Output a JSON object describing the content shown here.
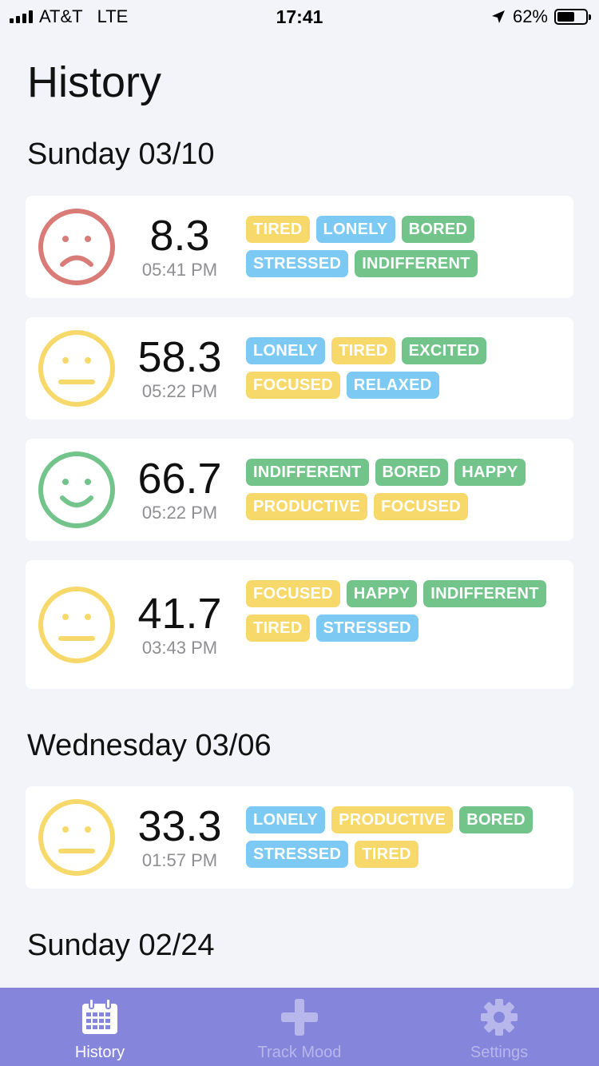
{
  "status_bar": {
    "carrier": "AT&T",
    "network": "LTE",
    "time": "17:41",
    "battery": "62%",
    "battery_level": 0.62
  },
  "page": {
    "title": "History"
  },
  "colors": {
    "red": "#d97b77",
    "yellow": "#f7d96b",
    "green": "#72c48b",
    "blue": "#7ccaf4",
    "tabbar": "#8585dc"
  },
  "sections": [
    {
      "title": "Sunday 03/10",
      "entries": [
        {
          "mood": "sad",
          "score": "8.3",
          "time": "05:41 PM",
          "tags": [
            {
              "label": "TIRED",
              "color": "yellow"
            },
            {
              "label": "LONELY",
              "color": "blue"
            },
            {
              "label": "BORED",
              "color": "green"
            },
            {
              "label": "STRESSED",
              "color": "blue"
            },
            {
              "label": "INDIFFERENT",
              "color": "green"
            }
          ]
        },
        {
          "mood": "neutral",
          "score": "58.3",
          "time": "05:22 PM",
          "tags": [
            {
              "label": "LONELY",
              "color": "blue"
            },
            {
              "label": "TIRED",
              "color": "yellow"
            },
            {
              "label": "EXCITED",
              "color": "green"
            },
            {
              "label": "FOCUSED",
              "color": "yellow"
            },
            {
              "label": "RELAXED",
              "color": "blue"
            }
          ]
        },
        {
          "mood": "happy",
          "score": "66.7",
          "time": "05:22 PM",
          "tags": [
            {
              "label": "INDIFFERENT",
              "color": "green"
            },
            {
              "label": "BORED",
              "color": "green"
            },
            {
              "label": "HAPPY",
              "color": "green"
            },
            {
              "label": "PRODUCTIVE",
              "color": "yellow"
            },
            {
              "label": "FOCUSED",
              "color": "yellow"
            }
          ]
        },
        {
          "mood": "neutral",
          "score": "41.7",
          "time": "03:43 PM",
          "tags": [
            {
              "label": "FOCUSED",
              "color": "yellow"
            },
            {
              "label": "HAPPY",
              "color": "green"
            },
            {
              "label": "INDIFFERENT",
              "color": "green"
            },
            {
              "label": "TIRED",
              "color": "yellow"
            },
            {
              "label": "STRESSED",
              "color": "blue"
            }
          ]
        }
      ]
    },
    {
      "title": "Wednesday 03/06",
      "entries": [
        {
          "mood": "neutral",
          "score": "33.3",
          "time": "01:57 PM",
          "tags": [
            {
              "label": "LONELY",
              "color": "blue"
            },
            {
              "label": "PRODUCTIVE",
              "color": "yellow"
            },
            {
              "label": "BORED",
              "color": "green"
            },
            {
              "label": "STRESSED",
              "color": "blue"
            },
            {
              "label": "TIRED",
              "color": "yellow"
            }
          ]
        }
      ]
    },
    {
      "title": "Sunday 02/24",
      "entries": []
    }
  ],
  "tabbar": {
    "tabs": [
      {
        "label": "History",
        "icon": "calendar-icon",
        "active": true
      },
      {
        "label": "Track Mood",
        "icon": "plus-icon",
        "active": false
      },
      {
        "label": "Settings",
        "icon": "gear-icon",
        "active": false
      }
    ]
  }
}
